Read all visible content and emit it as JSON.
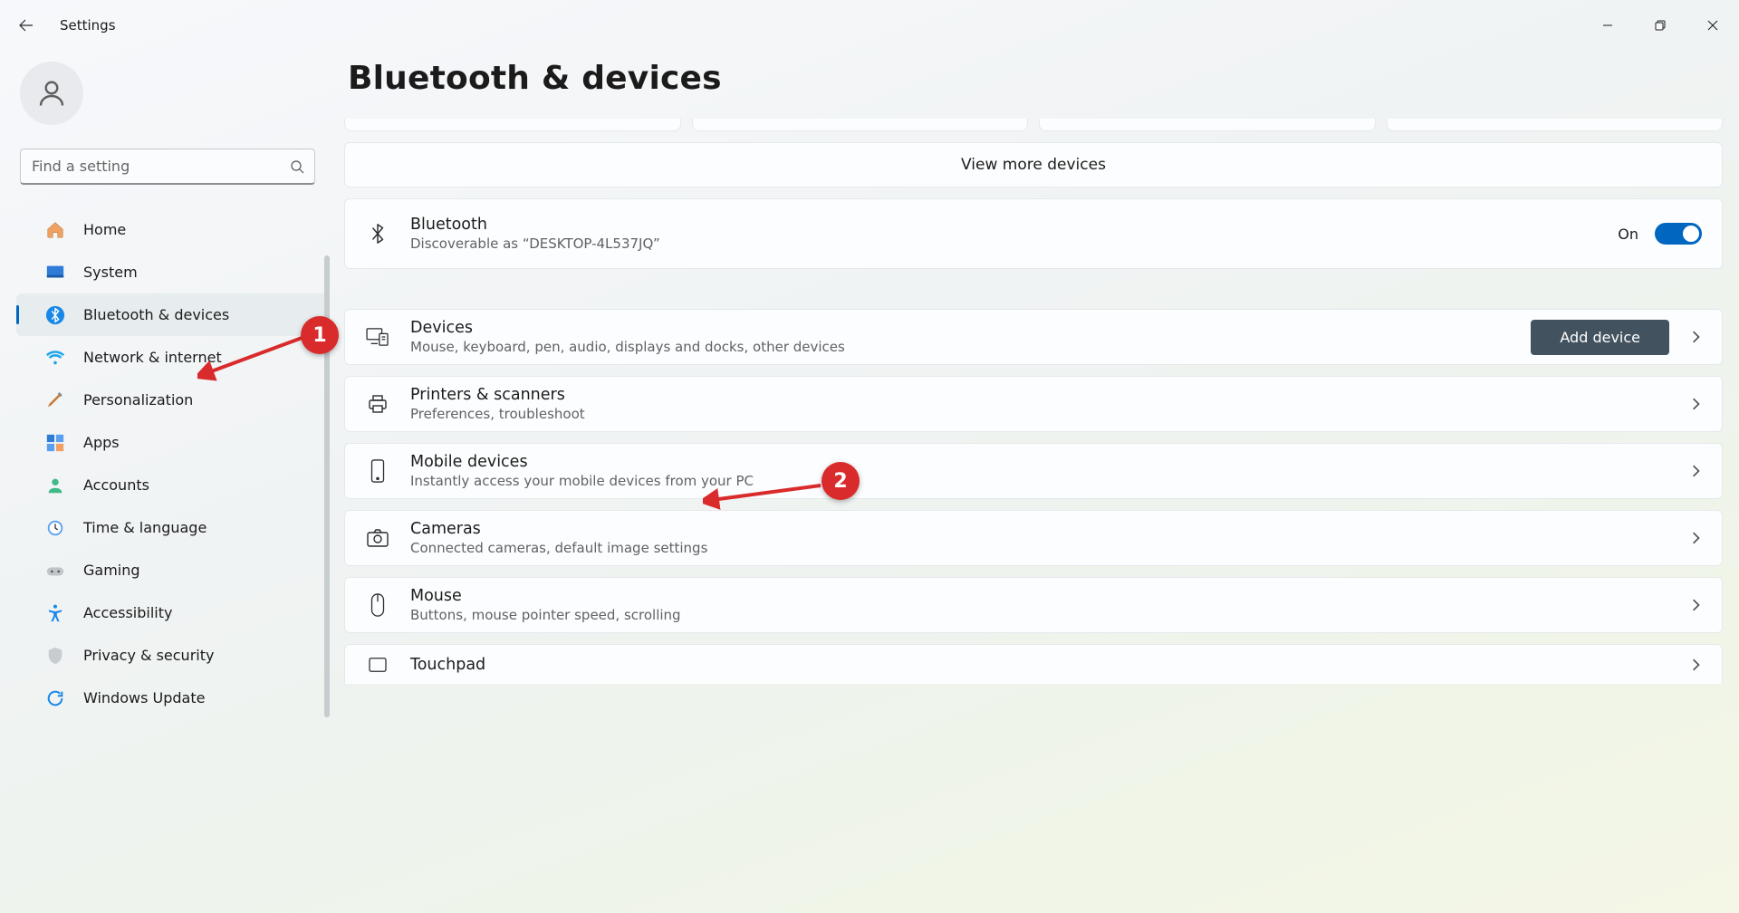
{
  "window": {
    "title": "Settings"
  },
  "search": {
    "placeholder": "Find a setting"
  },
  "sidebar": {
    "items": [
      {
        "id": "home",
        "label": "Home"
      },
      {
        "id": "system",
        "label": "System"
      },
      {
        "id": "bluetooth",
        "label": "Bluetooth & devices"
      },
      {
        "id": "network",
        "label": "Network & internet"
      },
      {
        "id": "personalization",
        "label": "Personalization"
      },
      {
        "id": "apps",
        "label": "Apps"
      },
      {
        "id": "accounts",
        "label": "Accounts"
      },
      {
        "id": "time",
        "label": "Time & language"
      },
      {
        "id": "gaming",
        "label": "Gaming"
      },
      {
        "id": "accessibility",
        "label": "Accessibility"
      },
      {
        "id": "privacy",
        "label": "Privacy & security"
      },
      {
        "id": "update",
        "label": "Windows Update"
      }
    ]
  },
  "page": {
    "title": "Bluetooth & devices",
    "view_more": "View more devices",
    "bluetooth": {
      "title": "Bluetooth",
      "subtitle": "Discoverable as “DESKTOP-4L537JQ”",
      "state_label": "On"
    },
    "cards": [
      {
        "id": "devices",
        "title": "Devices",
        "subtitle": "Mouse, keyboard, pen, audio, displays and docks, other devices",
        "action": "Add device"
      },
      {
        "id": "printers",
        "title": "Printers & scanners",
        "subtitle": "Preferences, troubleshoot"
      },
      {
        "id": "mobile",
        "title": "Mobile devices",
        "subtitle": "Instantly access your mobile devices from your PC"
      },
      {
        "id": "cameras",
        "title": "Cameras",
        "subtitle": "Connected cameras, default image settings"
      },
      {
        "id": "mouse",
        "title": "Mouse",
        "subtitle": "Buttons, mouse pointer speed, scrolling"
      },
      {
        "id": "touchpad",
        "title": "Touchpad",
        "subtitle": ""
      }
    ]
  },
  "annotations": {
    "badge1": "1",
    "badge2": "2"
  }
}
